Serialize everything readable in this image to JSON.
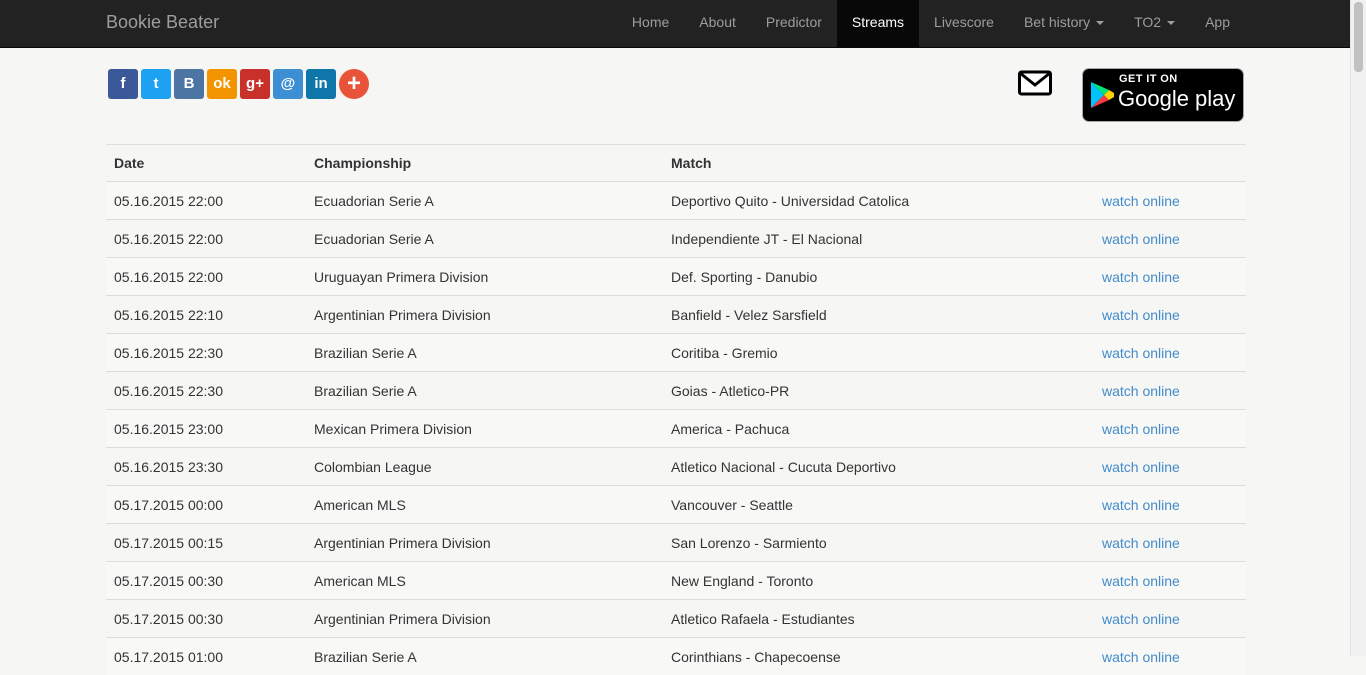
{
  "navbar": {
    "brand": "Bookie Beater",
    "items": [
      {
        "label": "Home",
        "active": false,
        "dropdown": false
      },
      {
        "label": "About",
        "active": false,
        "dropdown": false
      },
      {
        "label": "Predictor",
        "active": false,
        "dropdown": false
      },
      {
        "label": "Streams",
        "active": true,
        "dropdown": false
      },
      {
        "label": "Livescore",
        "active": false,
        "dropdown": false
      },
      {
        "label": "Bet history",
        "active": false,
        "dropdown": true
      },
      {
        "label": "TO2",
        "active": false,
        "dropdown": true
      },
      {
        "label": "App",
        "active": false,
        "dropdown": false
      }
    ]
  },
  "share": [
    {
      "name": "facebook-share-icon",
      "glyph": "f",
      "color": "#3b5998"
    },
    {
      "name": "twitter-share-icon",
      "glyph": "t",
      "color": "#1da1f2"
    },
    {
      "name": "vk-share-icon",
      "glyph": "B",
      "color": "#4c75a3"
    },
    {
      "name": "odnoklassniki-share-icon",
      "glyph": "ok",
      "color": "#f29400"
    },
    {
      "name": "google-plus-share-icon",
      "glyph": "g+",
      "color": "#c8302a"
    },
    {
      "name": "moi-mir-share-icon",
      "glyph": "@",
      "color": "#3c8fd3"
    },
    {
      "name": "linkedin-share-icon",
      "glyph": "in",
      "color": "#0e76a8"
    },
    {
      "name": "more-share-icon",
      "glyph": "+",
      "color": "#e9533a"
    }
  ],
  "google_play": {
    "top": "GET IT ON",
    "bottom": "Google play"
  },
  "table": {
    "headers": [
      "Date",
      "Championship",
      "Match",
      ""
    ],
    "link_color": "#428bca",
    "rows": [
      {
        "date": "05.16.2015 22:00",
        "championship": "Ecuadorian Serie A",
        "match": "Deportivo Quito - Universidad Catolica",
        "link": "watch online"
      },
      {
        "date": "05.16.2015 22:00",
        "championship": "Ecuadorian Serie A",
        "match": "Independiente JT - El Nacional",
        "link": "watch online"
      },
      {
        "date": "05.16.2015 22:00",
        "championship": "Uruguayan Primera Division",
        "match": "Def. Sporting - Danubio",
        "link": "watch online"
      },
      {
        "date": "05.16.2015 22:10",
        "championship": "Argentinian Primera Division",
        "match": "Banfield - Velez Sarsfield",
        "link": "watch online"
      },
      {
        "date": "05.16.2015 22:30",
        "championship": "Brazilian Serie A",
        "match": "Coritiba - Gremio",
        "link": "watch online"
      },
      {
        "date": "05.16.2015 22:30",
        "championship": "Brazilian Serie A",
        "match": "Goias - Atletico-PR",
        "link": "watch online"
      },
      {
        "date": "05.16.2015 23:00",
        "championship": "Mexican Primera Division",
        "match": "America - Pachuca",
        "link": "watch online"
      },
      {
        "date": "05.16.2015 23:30",
        "championship": "Colombian League",
        "match": "Atletico Nacional - Cucuta Deportivo",
        "link": "watch online"
      },
      {
        "date": "05.17.2015 00:00",
        "championship": "American MLS",
        "match": "Vancouver - Seattle",
        "link": "watch online"
      },
      {
        "date": "05.17.2015 00:15",
        "championship": "Argentinian Primera Division",
        "match": "San Lorenzo - Sarmiento",
        "link": "watch online"
      },
      {
        "date": "05.17.2015 00:30",
        "championship": "American MLS",
        "match": "New England - Toronto",
        "link": "watch online"
      },
      {
        "date": "05.17.2015 00:30",
        "championship": "Argentinian Primera Division",
        "match": "Atletico Rafaela - Estudiantes",
        "link": "watch online"
      },
      {
        "date": "05.17.2015 01:00",
        "championship": "Brazilian Serie A",
        "match": "Corinthians - Chapecoense",
        "link": "watch online"
      }
    ]
  }
}
